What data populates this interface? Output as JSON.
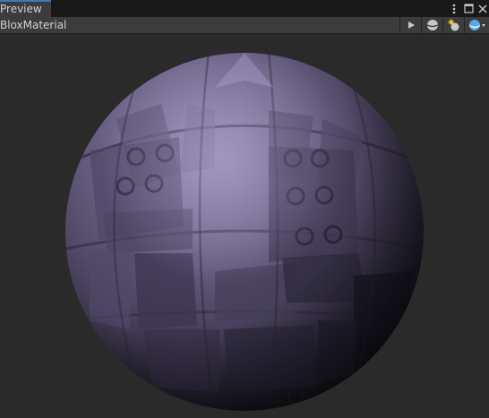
{
  "tab": {
    "label": "Preview"
  },
  "header": {
    "title": "BloxMaterial"
  },
  "toolbar": {
    "buttons": [
      "play-icon",
      "sphere-mesh-icon",
      "lighting-icon",
      "background-icon"
    ]
  },
  "window_controls": [
    "more-options-icon",
    "maximize-icon",
    "close-icon"
  ],
  "colors": {
    "tab_accent": "#3a79bb",
    "material_base": "#6e6585",
    "background": "#2a2a2a"
  }
}
